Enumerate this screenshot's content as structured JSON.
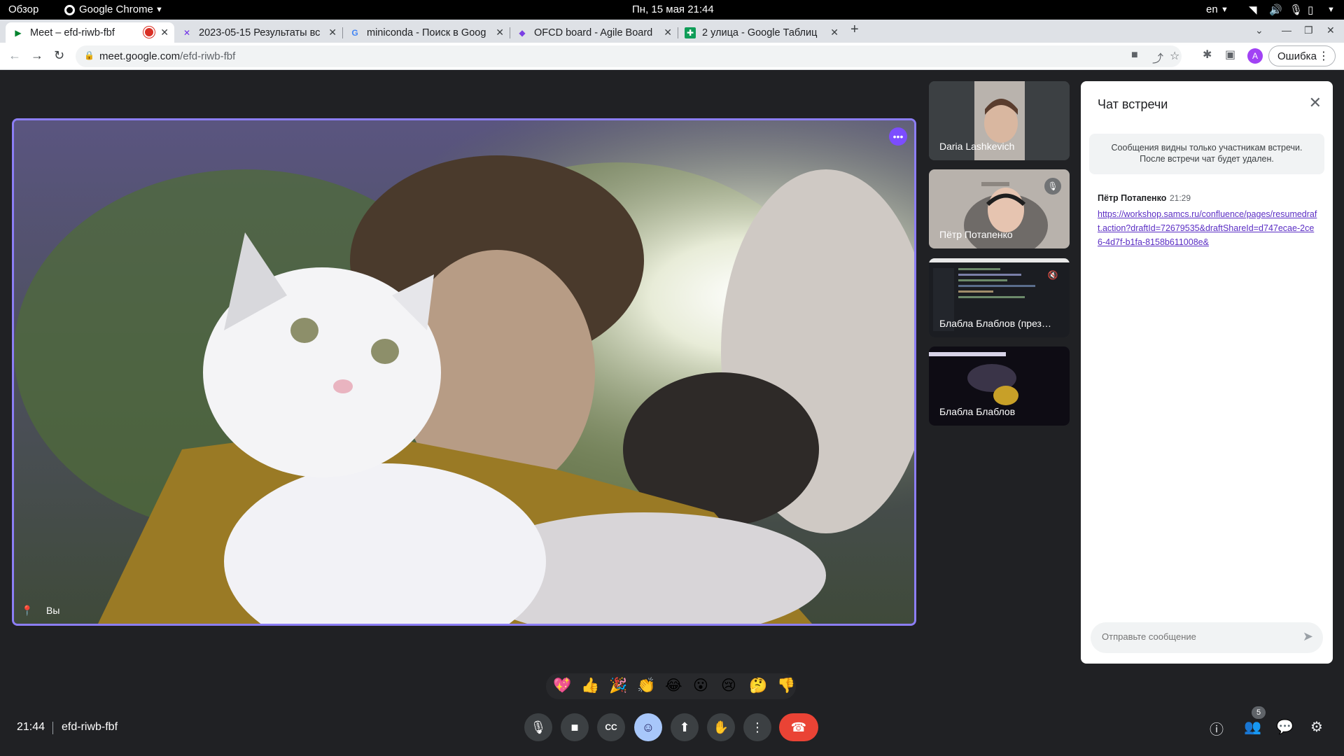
{
  "system_bar": {
    "overview": "Обзор",
    "app": "Google Chrome",
    "datetime": "Пн, 15 мая  21:44",
    "lang": "en"
  },
  "tabs": [
    {
      "title": "Meet – efd-riwb-fbf",
      "active": true,
      "recording": true
    },
    {
      "title": "2023-05-15 Результаты вс",
      "active": false
    },
    {
      "title": "miniconda - Поиск в Goog",
      "active": false
    },
    {
      "title": "OFCD board - Agile Board",
      "active": false
    },
    {
      "title": "2 улица - Google Таблиц",
      "active": false
    }
  ],
  "toolbar": {
    "url_host": "meet.google.com",
    "url_path": "/efd-riwb-fbf",
    "error_button": "Ошибка",
    "profile_initial": "A"
  },
  "main_video": {
    "self_label": "Вы"
  },
  "participants": [
    {
      "name": "Daria Lashkevich",
      "muted": false
    },
    {
      "name": "Пётр Потапенко",
      "muted": true
    },
    {
      "name": "Блабла Блаблов (през…",
      "muted": true
    },
    {
      "name": "Блабла Блаблов",
      "muted": false
    }
  ],
  "chat": {
    "title": "Чат встречи",
    "note_line1": "Сообщения видны только участникам встречи.",
    "note_line2": "После встречи чат будет удален.",
    "messages": [
      {
        "author": "Пётр Потапенко",
        "time": "21:29",
        "text": "https://workshop.samcs.ru/confluence/pages/resumedraft.action?draftId=72679535&draftShareId=d747ecae-2ce6-4d7f-b1fa-8158b611008e&"
      }
    ],
    "input_placeholder": "Отправьте сообщение"
  },
  "reactions": [
    "💖",
    "👍",
    "🎉",
    "👏",
    "😂",
    "😮",
    "😢",
    "🤔",
    "👎"
  ],
  "bottom_bar": {
    "time": "21:44",
    "meeting_code": "efd-riwb-fbf",
    "people_count": "5"
  },
  "colors": {
    "meet_bg": "#202124",
    "active_speaker_border": "#8c7ef5",
    "end_call": "#ea4335",
    "reaction_active": "#a8c7fa",
    "link": "#5b2ec4"
  }
}
